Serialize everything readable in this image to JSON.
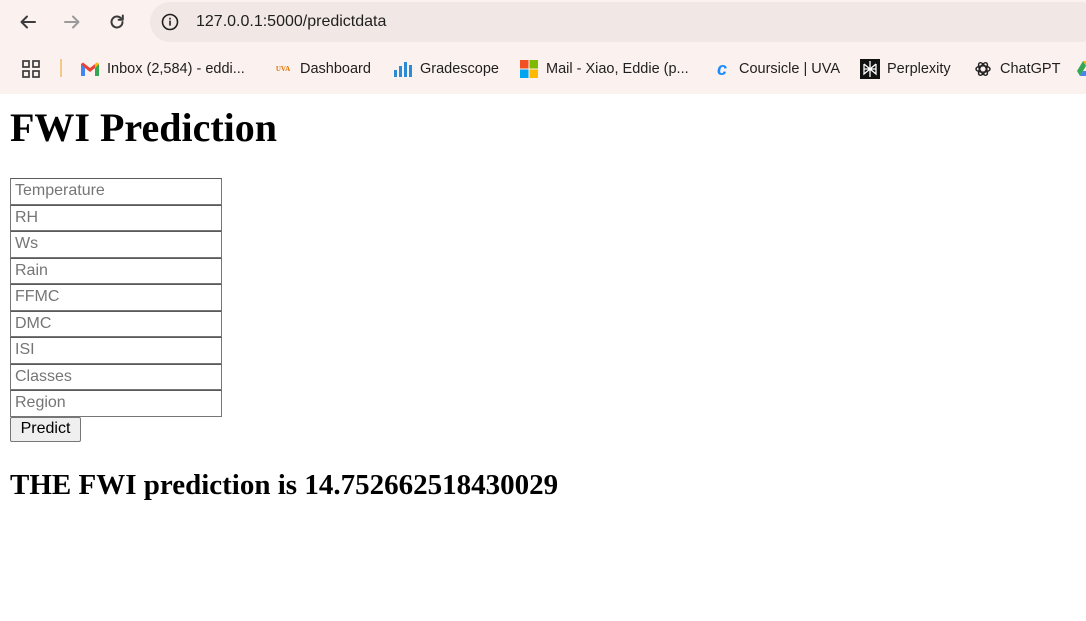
{
  "browser": {
    "url": "127.0.0.1:5000/predictdata",
    "bookmarks": [
      {
        "label": "Inbox (2,584) - eddi...",
        "icon": "gmail-icon"
      },
      {
        "label": "Dashboard",
        "icon": "uva-icon",
        "icon_text": "UVA"
      },
      {
        "label": "Gradescope",
        "icon": "gradescope-icon"
      },
      {
        "label": "Mail - Xiao, Eddie (p...",
        "icon": "microsoft-icon"
      },
      {
        "label": "Coursicle | UVA",
        "icon": "coursicle-icon"
      },
      {
        "label": "Perplexity",
        "icon": "perplexity-icon"
      },
      {
        "label": "ChatGPT",
        "icon": "chatgpt-icon"
      }
    ]
  },
  "page": {
    "title": "FWI Prediction",
    "fields": [
      {
        "name": "temperature",
        "placeholder": "Temperature",
        "value": ""
      },
      {
        "name": "rh",
        "placeholder": "RH",
        "value": ""
      },
      {
        "name": "ws",
        "placeholder": "Ws",
        "value": ""
      },
      {
        "name": "rain",
        "placeholder": "Rain",
        "value": ""
      },
      {
        "name": "ffmc",
        "placeholder": "FFMC",
        "value": ""
      },
      {
        "name": "dmc",
        "placeholder": "DMC",
        "value": ""
      },
      {
        "name": "isi",
        "placeholder": "ISI",
        "value": ""
      },
      {
        "name": "classes",
        "placeholder": "Classes",
        "value": ""
      },
      {
        "name": "region",
        "placeholder": "Region",
        "value": ""
      }
    ],
    "submit_label": "Predict",
    "result": "THE FWI prediction is 14.752662518430029"
  }
}
